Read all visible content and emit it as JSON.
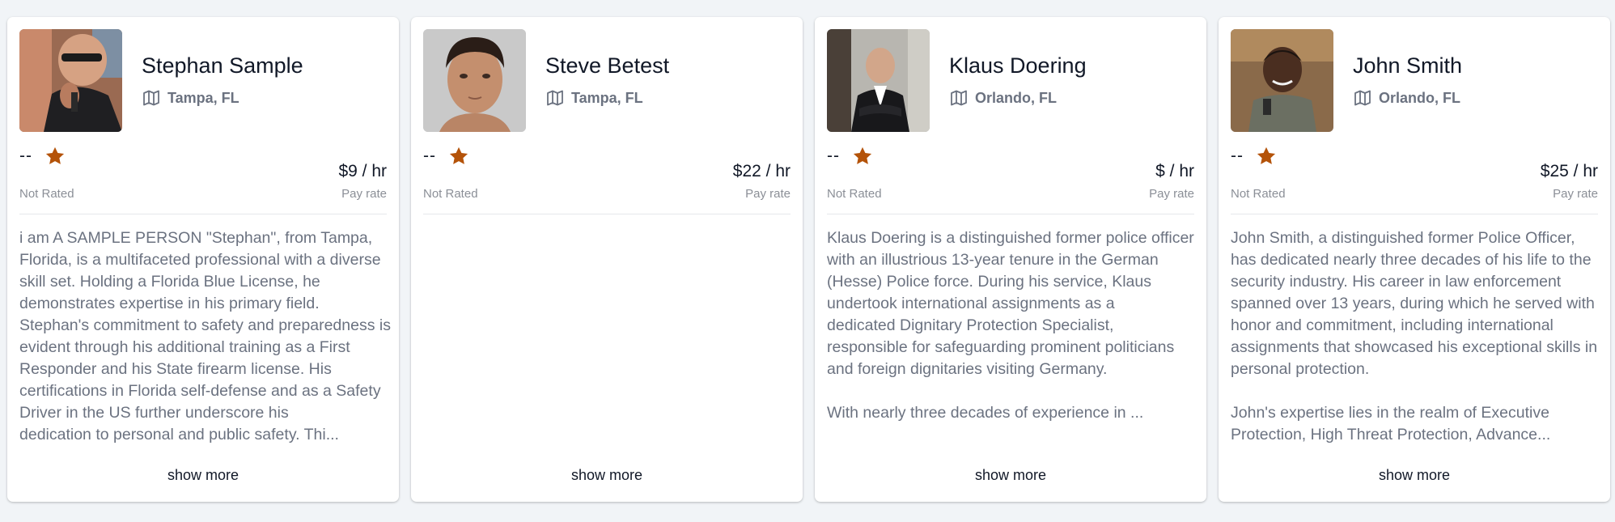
{
  "colors": {
    "page_background": "#f1f4f7",
    "card_background": "#ffffff",
    "star": "#b45309",
    "muted_text": "#6b7280",
    "primary_text": "#111827"
  },
  "icons": {
    "location": "map-icon",
    "rating": "star-icon"
  },
  "cards": [
    {
      "name": "Stephan Sample",
      "location": "Tampa, FL",
      "rating_value": "--",
      "rating_label": "Not Rated",
      "pay_rate": "$9 / hr",
      "pay_label": "Pay rate",
      "bio_lines": [
        "i am A SAMPLE PERSON \"Stephan\", from Tampa, Florida, is a multifaceted professional with a diverse skill set. Holding a Florida Blue License, he demonstrates expertise in his primary field. Stephan's commitment to safety and preparedness is evident through his additional training as a First Responder and his State firearm license. His certifications in Florida self-defense and as a Safety Driver in the US further underscore his",
        "dedication to personal and public safety. Thi..."
      ],
      "show_more": "show more"
    },
    {
      "name": "Steve Betest",
      "location": "Tampa, FL",
      "rating_value": "--",
      "rating_label": "Not Rated",
      "pay_rate": "$22 / hr",
      "pay_label": "Pay rate",
      "bio_lines": [
        "",
        ""
      ],
      "show_more": "show more"
    },
    {
      "name": "Klaus Doering",
      "location": "Orlando, FL",
      "rating_value": "--",
      "rating_label": "Not Rated",
      "pay_rate": "$ / hr",
      "pay_label": "Pay rate",
      "bio_lines": [
        "Klaus Doering is a distinguished former police officer with an illustrious 13-year tenure in the German (Hesse) Police force. During his service, Klaus undertook international assignments as a\ndedicated Dignitary Protection Specialist, responsible for safeguarding prominent politicians\nand foreign dignitaries visiting Germany.\n\n",
        "With nearly three decades of experience in ..."
      ],
      "show_more": "show more"
    },
    {
      "name": "John Smith",
      "location": "Orlando, FL",
      "rating_value": "--",
      "rating_label": "Not Rated",
      "pay_rate": "$25 / hr",
      "pay_label": "Pay rate",
      "bio_lines": [
        "John Smith, a distinguished former Police Officer, has dedicated nearly three decades of his life to the security industry. His career in law enforcement spanned over 13 years, during which he served with honor and commitment, including international assignments that showcased his exceptional skills in personal protection.\n\nJohn's expertise lies in the realm of Executive",
        "Protection, High Threat Protection, Advance..."
      ],
      "show_more": "show more"
    }
  ]
}
